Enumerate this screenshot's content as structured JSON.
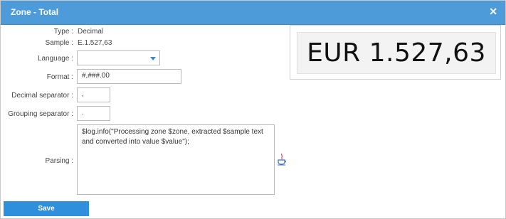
{
  "dialog": {
    "title": "Zone - Total",
    "close_glyph": "✕"
  },
  "info": {
    "type_label": "Type :",
    "type_value": "Decimal",
    "sample_label": "Sample :",
    "sample_value": "E.1.527,63"
  },
  "form": {
    "language_label": "Language :",
    "language_value": "",
    "format_label": "Format :",
    "format_value": "#,###.00",
    "decimal_separator_label": "Decimal separator :",
    "decimal_separator_value": ",",
    "grouping_separator_label": "Grouping separator :",
    "grouping_separator_value": ".",
    "parsing_label": "Parsing :",
    "parsing_value": "$log.info(\"Processing zone $zone, extracted $sample text and converted into value $value\");"
  },
  "preview": {
    "image_text": "EUR 1.527,63"
  },
  "actions": {
    "save_label": "Save"
  },
  "colors": {
    "titlebar": "#4d9bd8",
    "save_button": "#2f8fdc",
    "java_icon": "#d9534f"
  },
  "icons": {
    "close": "close-icon",
    "java": "java-icon",
    "dropdown": "chevron-down-icon"
  }
}
